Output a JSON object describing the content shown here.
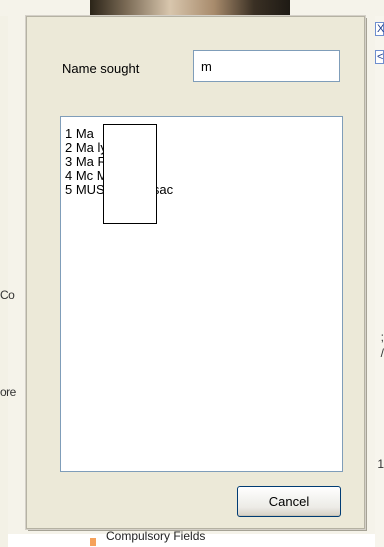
{
  "background": {
    "left_fragments": [
      "Co",
      "ore"
    ],
    "right_fragments": [
      ";",
      "/",
      "1"
    ],
    "right_links": [
      "X",
      "<"
    ],
    "bottom_text": "Compulsory Fields",
    "bottom_marker_color": "#f5a25b"
  },
  "dialog": {
    "name_label": "Name sought",
    "name_value": "m",
    "results": [
      "1 Ma",
      "2 Ma           ly",
      "3 Ma           Richard",
      "4 Mc           Margaret",
      "5 MUSHEY Musac"
    ],
    "cancel_label": "Cancel"
  }
}
